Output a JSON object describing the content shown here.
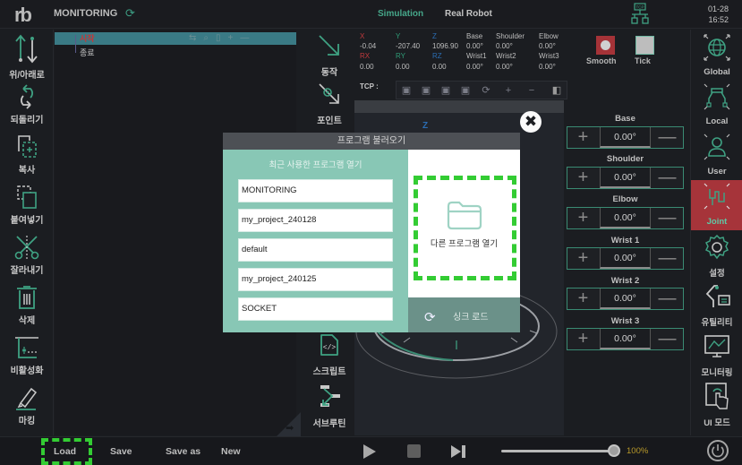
{
  "header": {
    "logo": "rb",
    "program_title": "MONITORING",
    "modes": [
      "Simulation",
      "Real Robot"
    ],
    "active_mode": "Simulation",
    "tcp_badge": "TCP",
    "date": "01-28",
    "time": "16:52"
  },
  "left_tools": [
    {
      "label": "위/아래로",
      "icon": "up-down-icon"
    },
    {
      "label": "되돌리기",
      "icon": "undo-icon"
    },
    {
      "label": "복사",
      "icon": "copy-icon"
    },
    {
      "label": "붙여넣기",
      "icon": "paste-icon"
    },
    {
      "label": "잘라내기",
      "icon": "cut-icon"
    },
    {
      "label": "삭제",
      "icon": "trash-icon"
    },
    {
      "label": "비활성화",
      "icon": "disable-icon"
    },
    {
      "label": "마킹",
      "icon": "marker-icon"
    }
  ],
  "tree": {
    "items": [
      "시작",
      "종료"
    ]
  },
  "mid_tools": [
    {
      "label": "동작",
      "icon": "move-icon"
    },
    {
      "label": "포인트",
      "icon": "point-icon"
    },
    {
      "label": "스크립트",
      "icon": "script-icon"
    },
    {
      "label": "서브루틴",
      "icon": "subroutine-icon"
    }
  ],
  "coords": {
    "cartesian": [
      {
        "key": "X",
        "value": "-0.04",
        "color": "#c0393c"
      },
      {
        "key": "Y",
        "value": "-207.40",
        "color": "#2f9c77"
      },
      {
        "key": "Z",
        "value": "1096.90",
        "color": "#2b6db3"
      },
      {
        "key": "RX",
        "value": "0.00",
        "color": "#c0393c"
      },
      {
        "key": "RY",
        "value": "0.00",
        "color": "#2f9c77"
      },
      {
        "key": "RZ",
        "value": "0.00",
        "color": "#2b6db3"
      }
    ],
    "joints": [
      {
        "key": "Base",
        "value": "0.00°"
      },
      {
        "key": "Shoulder",
        "value": "0.00°"
      },
      {
        "key": "Elbow",
        "value": "0.00°"
      },
      {
        "key": "Wrist1",
        "value": "0.00°"
      },
      {
        "key": "Wrist2",
        "value": "0.00°"
      },
      {
        "key": "Wrist3",
        "value": "0.00°"
      }
    ],
    "tcp_label": "TCP :",
    "view_axis_label": "Z"
  },
  "motion_options": {
    "smooth_label": "Smooth",
    "tick_label": "Tick",
    "smooth_on": true
  },
  "jog": {
    "plus": "+",
    "minus": "—",
    "joints": [
      {
        "name": "Base",
        "value": "0.00°"
      },
      {
        "name": "Shoulder",
        "value": "0.00°"
      },
      {
        "name": "Elbow",
        "value": "0.00°"
      },
      {
        "name": "Wrist 1",
        "value": "0.00°"
      },
      {
        "name": "Wrist 2",
        "value": "0.00°"
      },
      {
        "name": "Wrist 3",
        "value": "0.00°"
      }
    ]
  },
  "right_tools": [
    {
      "label": "Global",
      "icon": "globe-icon"
    },
    {
      "label": "Local",
      "icon": "local-frame-icon"
    },
    {
      "label": "User",
      "icon": "user-frame-icon"
    },
    {
      "label": "Joint",
      "icon": "joint-icon",
      "active": true
    },
    {
      "label": "설정",
      "icon": "gear-icon"
    },
    {
      "label": "유틸리티",
      "icon": "utility-icon"
    },
    {
      "label": "모니터링",
      "icon": "monitor-icon"
    },
    {
      "label": "UI 모드",
      "icon": "touch-icon"
    }
  ],
  "modal": {
    "title": "프로그램 불러오기",
    "recent_title": "최근 사용한 프로그램 열기",
    "recent": [
      "MONITORING",
      "my_project_240128",
      "default",
      "my_project_240125",
      "SOCKET"
    ],
    "other_label": "다른 프로그램 열기",
    "sync_label": "싱크 로드",
    "close_symbol": "✖"
  },
  "bottom": {
    "buttons": [
      "Load",
      "Save",
      "Save as",
      "New"
    ],
    "speed": "100%",
    "speed_fraction": 1.0
  },
  "colors": {
    "accent": "#46a78a",
    "active_tab_bg": "#a6343a",
    "modal_bg": "#88c7b5",
    "highlight": "#33cc33",
    "speed_text": "#b99a2a"
  }
}
